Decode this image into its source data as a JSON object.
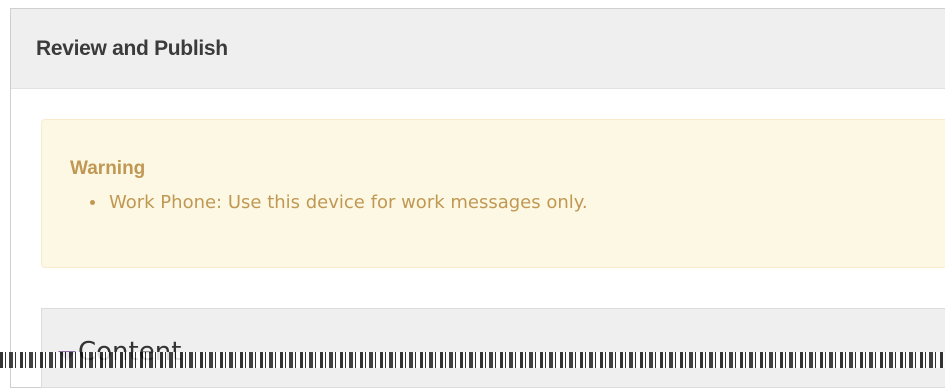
{
  "panel": {
    "title": "Review and Publish"
  },
  "warning": {
    "title": "Warning",
    "items": [
      "Work Phone: Use this device for work messages only."
    ],
    "color": "#c09853",
    "background": "#fcf8e3"
  },
  "content_section": {
    "label": "Content",
    "expanded": true,
    "icon": "triangle-down-icon"
  }
}
